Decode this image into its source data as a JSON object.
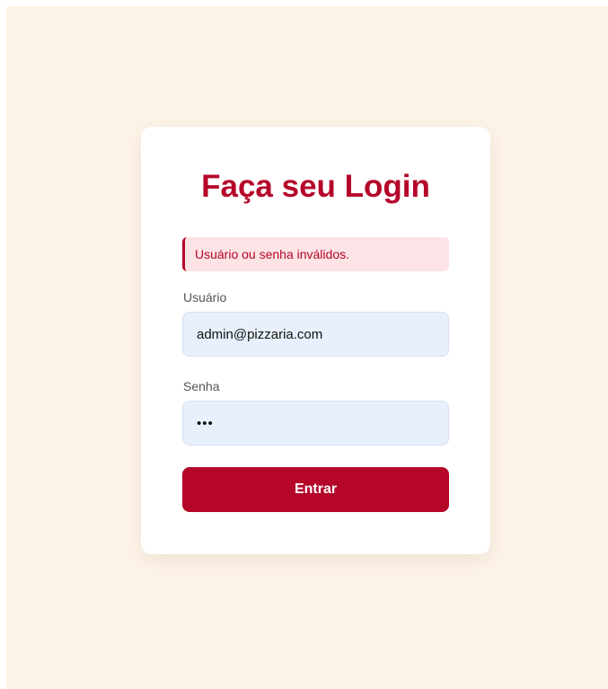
{
  "login": {
    "title": "Faça seu Login",
    "error_message": "Usuário ou senha inválidos.",
    "username_label": "Usuário",
    "username_value": "admin@pizzaria.com",
    "password_label": "Senha",
    "password_value": "abc",
    "submit_label": "Entrar"
  },
  "colors": {
    "accent": "#b5062a",
    "page_background": "#fdf4e8",
    "card_background": "#ffffff",
    "error_background": "#fde3e5",
    "input_background": "#e8f0fd"
  }
}
